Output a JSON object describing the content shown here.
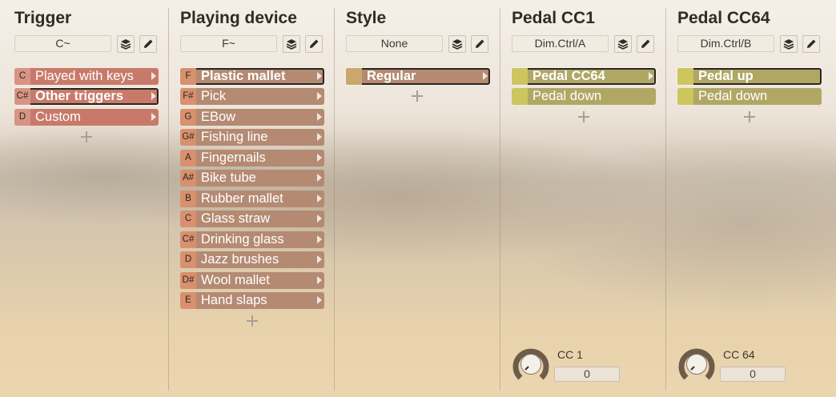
{
  "columns": [
    {
      "title": "Trigger",
      "dropdown": "C~",
      "items": [
        {
          "key": "C",
          "label": "Played with keys",
          "selected": false
        },
        {
          "key": "C#",
          "label": "Other triggers",
          "selected": true
        },
        {
          "key": "D",
          "label": "Custom",
          "selected": false
        }
      ]
    },
    {
      "title": "Playing device",
      "dropdown": "F~",
      "items": [
        {
          "key": "F",
          "label": "Plastic mallet",
          "selected": true
        },
        {
          "key": "F#",
          "label": "Pick",
          "selected": false
        },
        {
          "key": "G",
          "label": "EBow",
          "selected": false
        },
        {
          "key": "G#",
          "label": "Fishing line",
          "selected": false
        },
        {
          "key": "A",
          "label": "Fingernails",
          "selected": false
        },
        {
          "key": "A#",
          "label": "Bike tube",
          "selected": false
        },
        {
          "key": "B",
          "label": "Rubber mallet",
          "selected": false
        },
        {
          "key": "C",
          "label": "Glass straw",
          "selected": false
        },
        {
          "key": "C#",
          "label": "Drinking glass",
          "selected": false
        },
        {
          "key": "D",
          "label": "Jazz brushes",
          "selected": false
        },
        {
          "key": "D#",
          "label": "Wool mallet",
          "selected": false
        },
        {
          "key": "E",
          "label": "Hand slaps",
          "selected": false
        }
      ]
    },
    {
      "title": "Style",
      "dropdown": "None",
      "items": [
        {
          "key": "",
          "label": "Regular",
          "selected": true
        }
      ]
    },
    {
      "title": "Pedal CC1",
      "dropdown": "Dim.Ctrl/A",
      "items": [
        {
          "key": "",
          "label": "Pedal CC64",
          "selected": true
        },
        {
          "key": "",
          "label": "Pedal down",
          "selected": false
        }
      ],
      "knob": {
        "label": "CC 1",
        "value": "0"
      }
    },
    {
      "title": "Pedal CC64",
      "dropdown": "Dim.Ctrl/B",
      "items": [
        {
          "key": "",
          "label": "Pedal up",
          "selected": true
        },
        {
          "key": "",
          "label": "Pedal down",
          "selected": false
        }
      ],
      "knob": {
        "label": "CC 64",
        "value": "0"
      }
    }
  ],
  "icons": {
    "layers": "layers-icon",
    "edit": "pencil-icon",
    "add": "plus-icon",
    "submenu": "chevron-right-icon"
  },
  "colors": {
    "trigger": "#c87a6a",
    "device": "#b48a72",
    "style": "#b4966e",
    "pedal": "#b1a765"
  }
}
